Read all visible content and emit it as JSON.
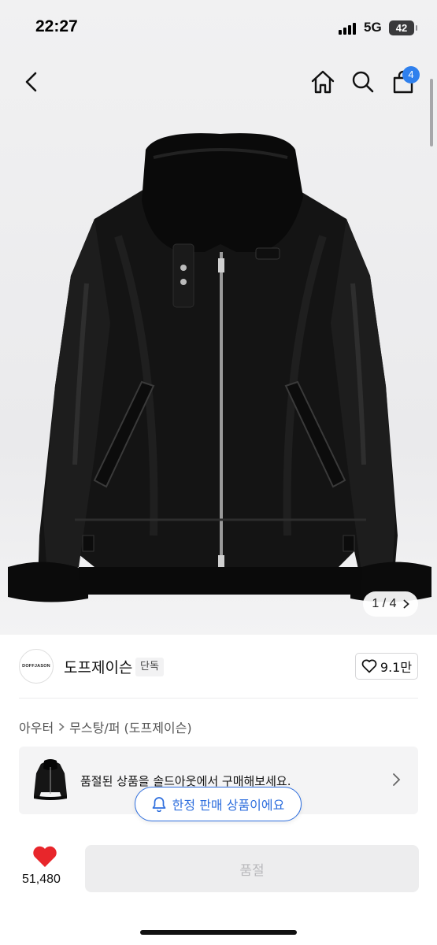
{
  "status_bar": {
    "time": "22:27",
    "network": "5G",
    "battery": "42"
  },
  "header": {
    "cart_count": "4"
  },
  "gallery": {
    "counter": "1 / 4"
  },
  "brand": {
    "logo_text": "DOFFJASON",
    "name": "도프제이슨",
    "tag": "단독",
    "likes": "9.1만"
  },
  "breadcrumb": {
    "category": "아우터",
    "subcategory": "무스탕/퍼 (도프제이슨)"
  },
  "soldout_banner": {
    "text": "품절된 상품을 솔드아웃에서 구매해보세요."
  },
  "limited_pill": {
    "text": "한정 판매 상품이에요"
  },
  "bottom_bar": {
    "like_count": "51,480",
    "button_label": "품절"
  },
  "colors": {
    "accent": "#2f80ed",
    "pill_blue": "#2f6fde",
    "heart_red": "#e8262b"
  }
}
